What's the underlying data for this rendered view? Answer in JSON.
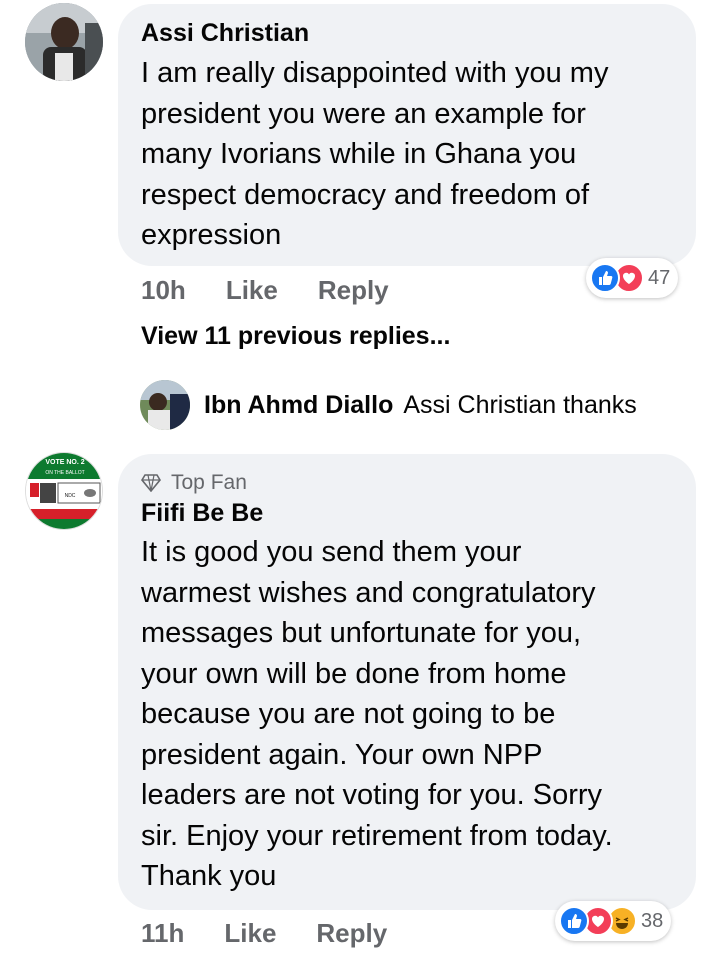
{
  "comment1": {
    "author": "Assi Christian",
    "lines": [
      "I am really disappointed with you my",
      "president you were an example for",
      "many Ivorians while in Ghana you",
      "respect democracy and freedom of",
      "expression"
    ],
    "time": "10h",
    "like_label": "Like",
    "reply_label": "Reply",
    "reaction_count": "47",
    "reactions": [
      "like-icon",
      "love-icon"
    ]
  },
  "view_previous": "View 11 previous replies...",
  "reply": {
    "author": "Ibn Ahmd Diallo",
    "text": "Assi Christian thanks"
  },
  "comment2": {
    "badge": "Top Fan",
    "author": "Fiifi Be Be",
    "lines": [
      "It is good you send them your",
      "warmest wishes and congratulatory",
      "messages but unfortunate for you,",
      "your own will be done from home",
      "because you are not going to be",
      "president again. Your own NPP",
      "leaders are not voting for you. Sorry",
      "sir. Enjoy your retirement from today.",
      "Thank you"
    ],
    "time": "11h",
    "like_label": "Like",
    "reply_label": "Reply",
    "reaction_count": "38",
    "reactions": [
      "like-icon",
      "love-icon",
      "haha-icon"
    ],
    "avatar_text": {
      "vote": "VOTE NO. 2",
      "ballot": "ON THE BALLOT",
      "party": "NDC"
    }
  },
  "colors": {
    "bubble": "#f0f2f5",
    "meta": "#65676b",
    "like_blue": "#1877f2",
    "love_red": "#f33e58",
    "haha_yellow": "#f7b125"
  }
}
